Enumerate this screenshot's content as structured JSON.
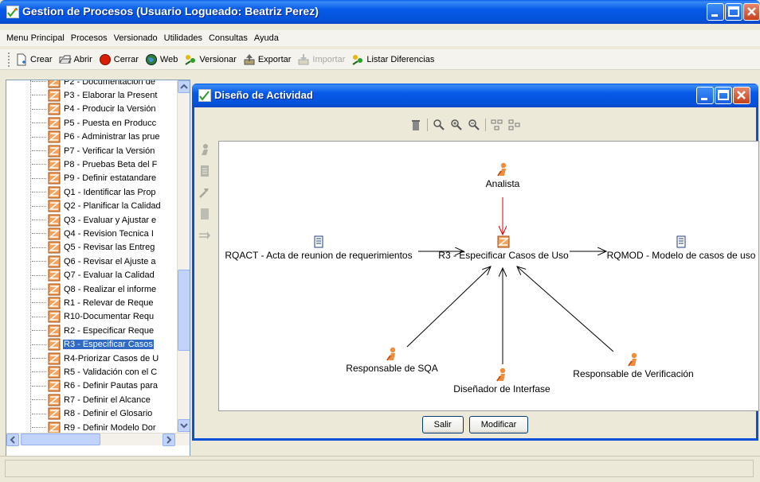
{
  "app": {
    "title": "Gestion de Procesos (Usuario Logueado: Beatriz Perez)"
  },
  "menu": [
    "Menu Principal",
    "Procesos",
    "Versionado",
    "Utilidades",
    "Consultas",
    "Ayuda"
  ],
  "toolbar": [
    {
      "label": "Crear",
      "icon": "new-document-icon",
      "enabled": true
    },
    {
      "label": "Abrir",
      "icon": "open-folder-icon",
      "enabled": true
    },
    {
      "label": "Cerrar",
      "icon": "close-red-circle-icon",
      "enabled": true
    },
    {
      "label": "Web",
      "icon": "globe-icon",
      "enabled": true
    },
    {
      "label": "Versionar",
      "icon": "versionar-people-icon",
      "enabled": true
    },
    {
      "label": "Exportar",
      "icon": "export-icon",
      "enabled": true
    },
    {
      "label": "Importar",
      "icon": "import-icon",
      "enabled": false
    },
    {
      "label": "Listar Diferencias",
      "icon": "diff-people-icon",
      "enabled": true
    }
  ],
  "tree": {
    "items": [
      "P2 - Documentacion de",
      "P3 - Elaborar la Present",
      "P4 - Producir la Versión",
      "P5 - Puesta en Producc",
      "P6 - Administrar las prue",
      "P7 - Verificar la Versión",
      "P8 - Pruebas Beta del F",
      "P9 - Definir estatandare",
      "Q1 - Identificar las Prop",
      "Q2 - Planificar la Calidad",
      "Q3 - Evaluar y Ajustar e",
      "Q4 - Revision Tecnica I",
      "Q5 - Revisar las Entreg",
      "Q6 - Revisar el Ajuste a",
      "Q7 - Evaluar la Calidad",
      "Q8 - Realizar el informe",
      "R1 - Relevar de Reque",
      "R10-Documentar Requ",
      "R2 - Especificar Reque",
      "R3 - Especificar Casos",
      "R4-Priorizar Casos de U",
      "R5 - Validación con el C",
      "R6 - Definir Pautas para",
      "R7 - Definir el Alcance",
      "R8 - Definir el Glosario",
      "R9 - Definir Modelo Dor"
    ],
    "selected_index": 19
  },
  "child_window": {
    "title": "Diseño de Actividad",
    "diagram_tools": [
      "trash-icon",
      "zoom-fit-icon",
      "zoom-in-icon",
      "zoom-out-icon",
      "layout-icon",
      "layout-alt-icon"
    ],
    "palette": [
      "role-icon",
      "artifact-icon",
      "tool-icon",
      "document-icon",
      "flow-arrow-icon"
    ],
    "nodes": {
      "analista": "Analista",
      "input_artifact": "RQACT - Acta de reunion de requerimientos",
      "activity": "R3 - Especificar Casos de Uso",
      "output_artifact": "RQMOD - Modelo de casos de uso",
      "sqa": "Responsable de SQA",
      "interfase": "Diseñador de Interfase",
      "verificacion": "Responsable de Verificación"
    },
    "buttons": {
      "exit": "Salir",
      "modify": "Modificar"
    }
  }
}
